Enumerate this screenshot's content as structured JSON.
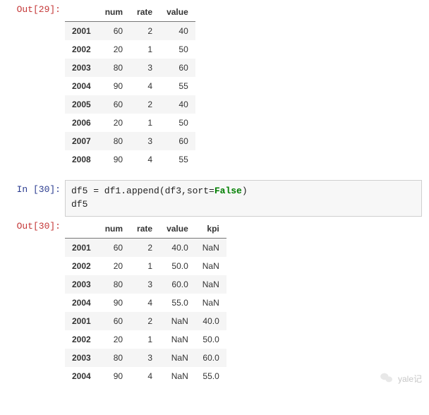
{
  "out29": {
    "label": "Out[29]:",
    "columns": [
      "num",
      "rate",
      "value"
    ],
    "index": [
      "2001",
      "2002",
      "2003",
      "2004",
      "2005",
      "2006",
      "2007",
      "2008"
    ],
    "rows": [
      [
        "60",
        "2",
        "40"
      ],
      [
        "20",
        "1",
        "50"
      ],
      [
        "80",
        "3",
        "60"
      ],
      [
        "90",
        "4",
        "55"
      ],
      [
        "60",
        "2",
        "40"
      ],
      [
        "20",
        "1",
        "50"
      ],
      [
        "80",
        "3",
        "60"
      ],
      [
        "90",
        "4",
        "55"
      ]
    ]
  },
  "in30": {
    "label": "In  [30]:",
    "code_pre": "df5 = df1.append(df3,sort=",
    "code_kw": "False",
    "code_post": ")\ndf5"
  },
  "out30": {
    "label": "Out[30]:",
    "columns": [
      "num",
      "rate",
      "value",
      "kpi"
    ],
    "index": [
      "2001",
      "2002",
      "2003",
      "2004",
      "2001",
      "2002",
      "2003",
      "2004"
    ],
    "rows": [
      [
        "60",
        "2",
        "40.0",
        "NaN"
      ],
      [
        "20",
        "1",
        "50.0",
        "NaN"
      ],
      [
        "80",
        "3",
        "60.0",
        "NaN"
      ],
      [
        "90",
        "4",
        "55.0",
        "NaN"
      ],
      [
        "60",
        "2",
        "NaN",
        "40.0"
      ],
      [
        "20",
        "1",
        "NaN",
        "50.0"
      ],
      [
        "80",
        "3",
        "NaN",
        "60.0"
      ],
      [
        "90",
        "4",
        "NaN",
        "55.0"
      ]
    ]
  },
  "watermark": {
    "text": "yale记"
  }
}
